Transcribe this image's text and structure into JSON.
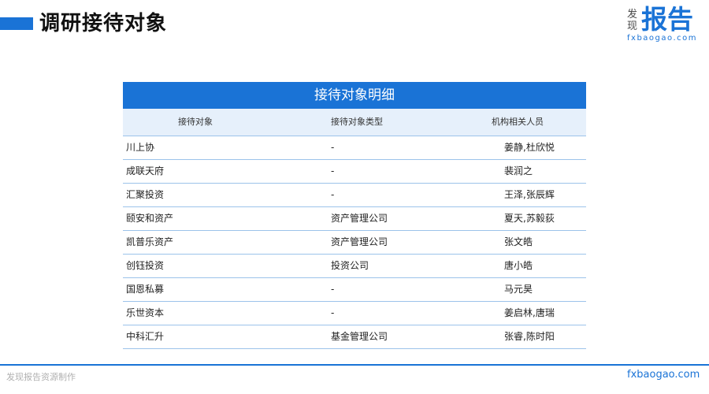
{
  "header": {
    "title": "调研接待对象"
  },
  "logo": {
    "small_top": "发",
    "small_bottom": "现",
    "big": "报告",
    "url": "fxbaogao.com"
  },
  "table": {
    "title": "接待对象明细",
    "columns": [
      "接待对象",
      "接待对象类型",
      "机构相关人员"
    ],
    "rows": [
      [
        "川上协",
        "-",
        "姜静,杜欣悦"
      ],
      [
        "成联天府",
        "-",
        "裴润之"
      ],
      [
        "汇聚投资",
        "-",
        "王泽,张辰辉"
      ],
      [
        "颐安和资产",
        "资产管理公司",
        "夏天,苏毅荻"
      ],
      [
        "凯普乐资产",
        "资产管理公司",
        "张文皓"
      ],
      [
        "创钰投资",
        "投资公司",
        "唐小皓"
      ],
      [
        "国恩私募",
        "-",
        "马元昊"
      ],
      [
        "乐世资本",
        "-",
        "姜启林,唐瑞"
      ],
      [
        "中科汇升",
        "基金管理公司",
        "张睿,陈时阳"
      ]
    ]
  },
  "footer": {
    "left": "发现报告资源制作",
    "right": "fxbaogao.com"
  },
  "colors": {
    "accent": "#1a73d6",
    "header_row_bg": "#e6f0fb",
    "row_border": "#9cc3ea"
  }
}
